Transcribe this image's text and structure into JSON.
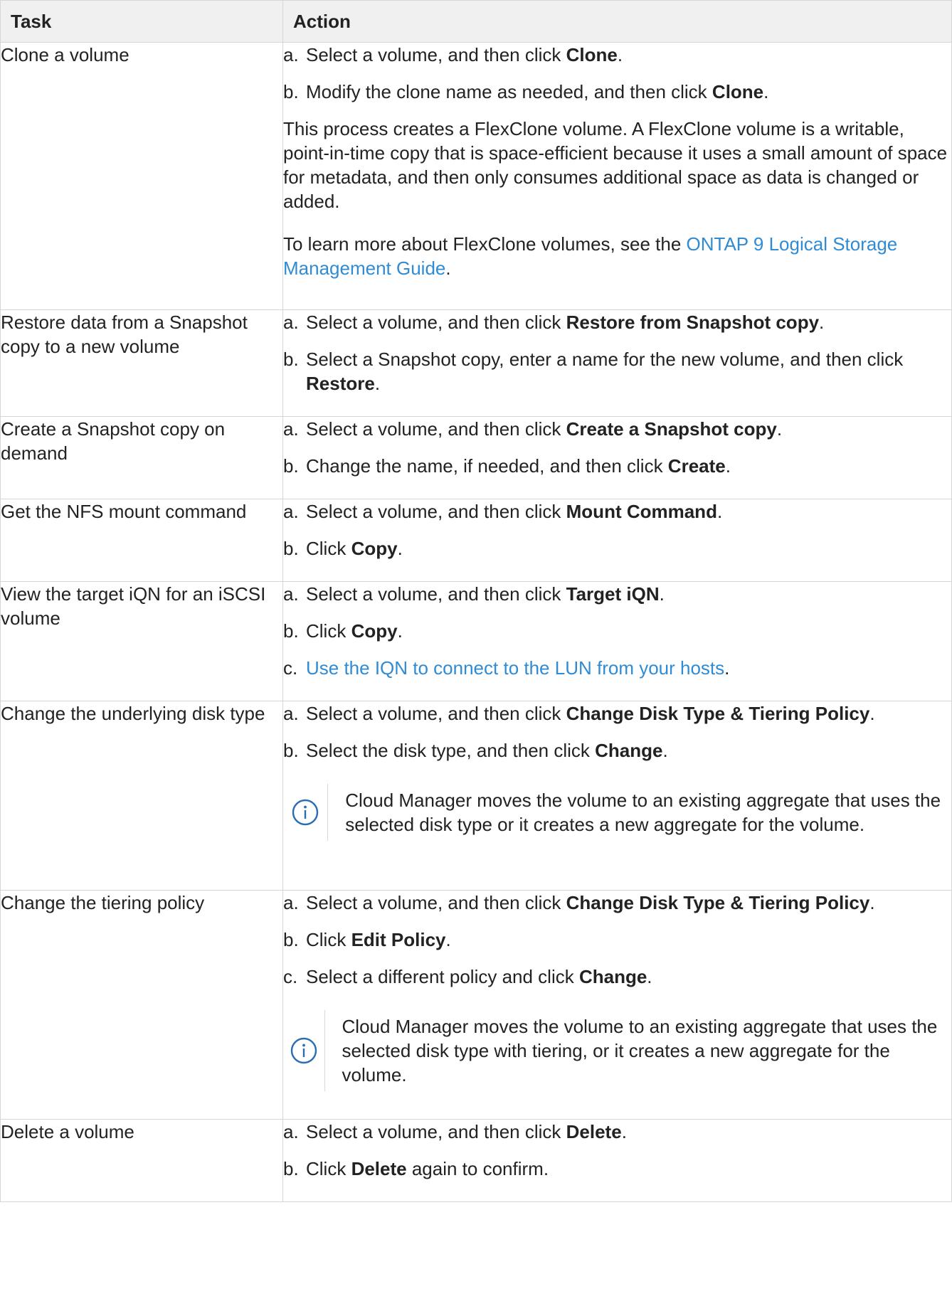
{
  "header": {
    "task": "Task",
    "action": "Action"
  },
  "rows": [
    {
      "task": "Clone a volume",
      "steps": [
        {
          "m": "a.",
          "t1": "Select a volume, and then click ",
          "b": "Clone",
          "t2": "."
        },
        {
          "m": "b.",
          "t1": "Modify the clone name as needed, and then click ",
          "b": "Clone",
          "t2": "."
        }
      ],
      "para1": "This process creates a FlexClone volume. A FlexClone volume is a writable, point-in-time copy that is space-efficient because it uses a small amount of space for metadata, and then only consumes additional space as data is changed or added.",
      "para2": {
        "pre": "To learn more about FlexClone volumes, see the ",
        "link": "ONTAP 9 Logical Storage Management Guide",
        "post": "."
      }
    },
    {
      "task": "Restore data from a Snapshot copy to a new volume",
      "steps": [
        {
          "m": "a.",
          "t1": "Select a volume, and then click ",
          "b": "Restore from Snapshot copy",
          "t2": "."
        },
        {
          "m": "b.",
          "t1": "Select a Snapshot copy, enter a name for the new volume, and then click ",
          "b": "Restore",
          "t2": "."
        }
      ]
    },
    {
      "task": "Create a Snapshot copy on demand",
      "steps": [
        {
          "m": "a.",
          "t1": "Select a volume, and then click ",
          "b": "Create a Snapshot copy",
          "t2": "."
        },
        {
          "m": "b.",
          "t1": "Change the name, if needed, and then click ",
          "b": "Create",
          "t2": "."
        }
      ]
    },
    {
      "task": "Get the NFS mount command",
      "steps": [
        {
          "m": "a.",
          "t1": "Select a volume, and then click ",
          "b": "Mount Command",
          "t2": "."
        },
        {
          "m": "b.",
          "t1": "Click ",
          "b": "Copy",
          "t2": "."
        }
      ]
    },
    {
      "task": "View the target iQN for an iSCSI volume",
      "steps": [
        {
          "m": "a.",
          "t1": "Select a volume, and then click ",
          "b": "Target iQN",
          "t2": "."
        },
        {
          "m": "b.",
          "t1": "Click ",
          "b": "Copy",
          "t2": "."
        },
        {
          "m": "c.",
          "link": "Use the IQN to connect to the LUN from your hosts",
          "t2": "."
        }
      ]
    },
    {
      "task": "Change the underlying disk type",
      "steps": [
        {
          "m": "a.",
          "t1": "Select a volume, and then click ",
          "b": "Change Disk Type & Tiering Policy",
          "t2": "."
        },
        {
          "m": "b.",
          "t1": "Select the disk type, and then click ",
          "b": "Change",
          "t2": "."
        }
      ],
      "note": "Cloud Manager moves the volume to an existing aggregate that uses the selected disk type or it creates a new aggregate for the volume."
    },
    {
      "task": "Change the tiering policy",
      "steps": [
        {
          "m": "a.",
          "t1": "Select a volume, and then click ",
          "b": "Change Disk Type & Tiering Policy",
          "t2": "."
        },
        {
          "m": "b.",
          "t1": "Click ",
          "b": "Edit Policy",
          "t2": "."
        },
        {
          "m": "c.",
          "t1": "Select a different policy and click ",
          "b": "Change",
          "t2": "."
        }
      ],
      "note": "Cloud Manager moves the volume to an existing aggregate that uses the selected disk type with tiering, or it creates a new aggregate for the volume."
    },
    {
      "task": "Delete a volume",
      "steps": [
        {
          "m": "a.",
          "t1": "Select a volume, and then click ",
          "b": "Delete",
          "t2": "."
        },
        {
          "m": "b.",
          "t1": "Click ",
          "b": "Delete",
          "t2": " again to confirm."
        }
      ]
    }
  ],
  "colors": {
    "link": "#2f8bd3",
    "header_bg": "#f0f0f0",
    "border": "#d6d6d6",
    "note_icon": "#2a6db3"
  },
  "icons": {
    "note": "info-icon"
  }
}
